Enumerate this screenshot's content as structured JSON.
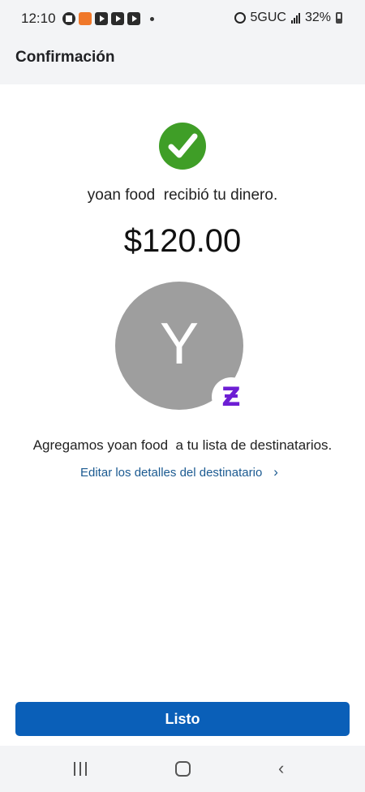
{
  "status_bar": {
    "time": "12:10",
    "network": "5GUC",
    "battery": "32%",
    "icons": [
      "chase-icon",
      "bank-app-icon",
      "youtube-icon",
      "youtube-icon",
      "youtube-icon",
      "alarm-icon",
      "signal-icon",
      "battery-icon"
    ]
  },
  "header": {
    "title": "Confirmación"
  },
  "confirmation": {
    "icon": "check-circle-icon",
    "received_text": "yoan food  recibió tu dinero.",
    "amount": "$120.00",
    "avatar_letter": "Y",
    "badge_icon": "zelle-icon",
    "badge_glyph": "Ƶ",
    "added_text": "Agregamos yoan food  a tu lista de destinatarios.",
    "edit_link": "Editar los detalles del destinatario",
    "edit_chevron": "›"
  },
  "actions": {
    "done_label": "Listo"
  },
  "nav_bar": {
    "back_glyph": "‹"
  },
  "colors": {
    "success": "#3f9e27",
    "primary": "#0a5fb8",
    "link": "#1b5a91",
    "zelle": "#6d1ed4",
    "avatar": "#9e9e9e"
  }
}
